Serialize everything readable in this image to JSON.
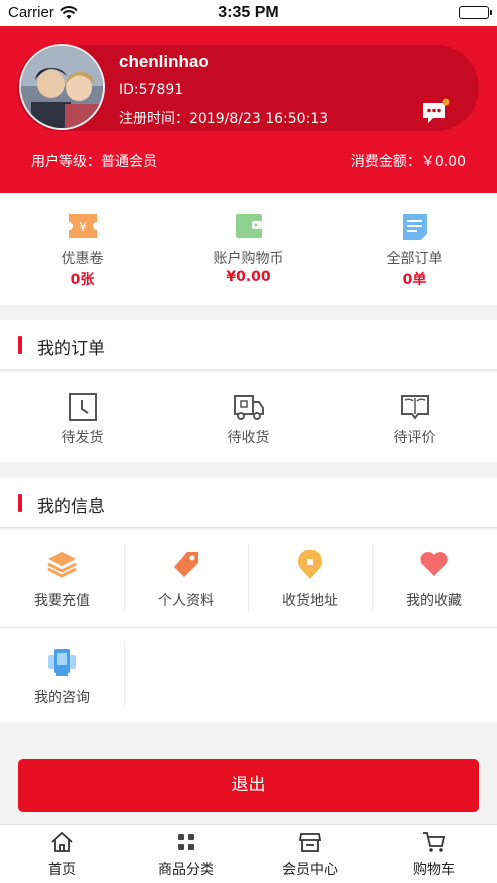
{
  "status_bar": {
    "carrier": "Carrier",
    "time": "3:35 PM"
  },
  "profile": {
    "username": "chenlinhao",
    "user_id": "ID:57891",
    "register_time": "注册时间：2019/8/23 16:50:13",
    "level": "用户等级：普通会员",
    "spend": "消费金额：￥0.00"
  },
  "stats": [
    {
      "label": "优惠卷",
      "value": "0张",
      "icon": "coupon-icon"
    },
    {
      "label": "账户购物币",
      "value": "¥0.00",
      "icon": "wallet-icon"
    },
    {
      "label": "全部订单",
      "value": "0单",
      "icon": "order-list-icon"
    }
  ],
  "orders": {
    "title": "我的订单",
    "items": [
      {
        "label": "待发货",
        "icon": "clock-icon"
      },
      {
        "label": "待收货",
        "icon": "truck-icon"
      },
      {
        "label": "待评价",
        "icon": "book-icon"
      }
    ]
  },
  "info": {
    "title": "我的信息",
    "items": [
      {
        "label": "我要充值",
        "icon": "layers-icon"
      },
      {
        "label": "个人资料",
        "icon": "tag-icon"
      },
      {
        "label": "收货地址",
        "icon": "location-icon"
      },
      {
        "label": "我的收藏",
        "icon": "heart-icon"
      },
      {
        "label": "我的咨询",
        "icon": "consult-icon"
      }
    ]
  },
  "logout_label": "退出",
  "tabs": [
    {
      "label": "首页",
      "icon": "home-icon"
    },
    {
      "label": "商品分类",
      "icon": "category-icon"
    },
    {
      "label": "会员中心",
      "icon": "member-icon"
    },
    {
      "label": "购物车",
      "icon": "cart-icon"
    }
  ],
  "colors": {
    "brand_red": "#e8102b",
    "orange": "#f7a35c",
    "green": "#8fd18f",
    "blue": "#6fb6ef"
  }
}
